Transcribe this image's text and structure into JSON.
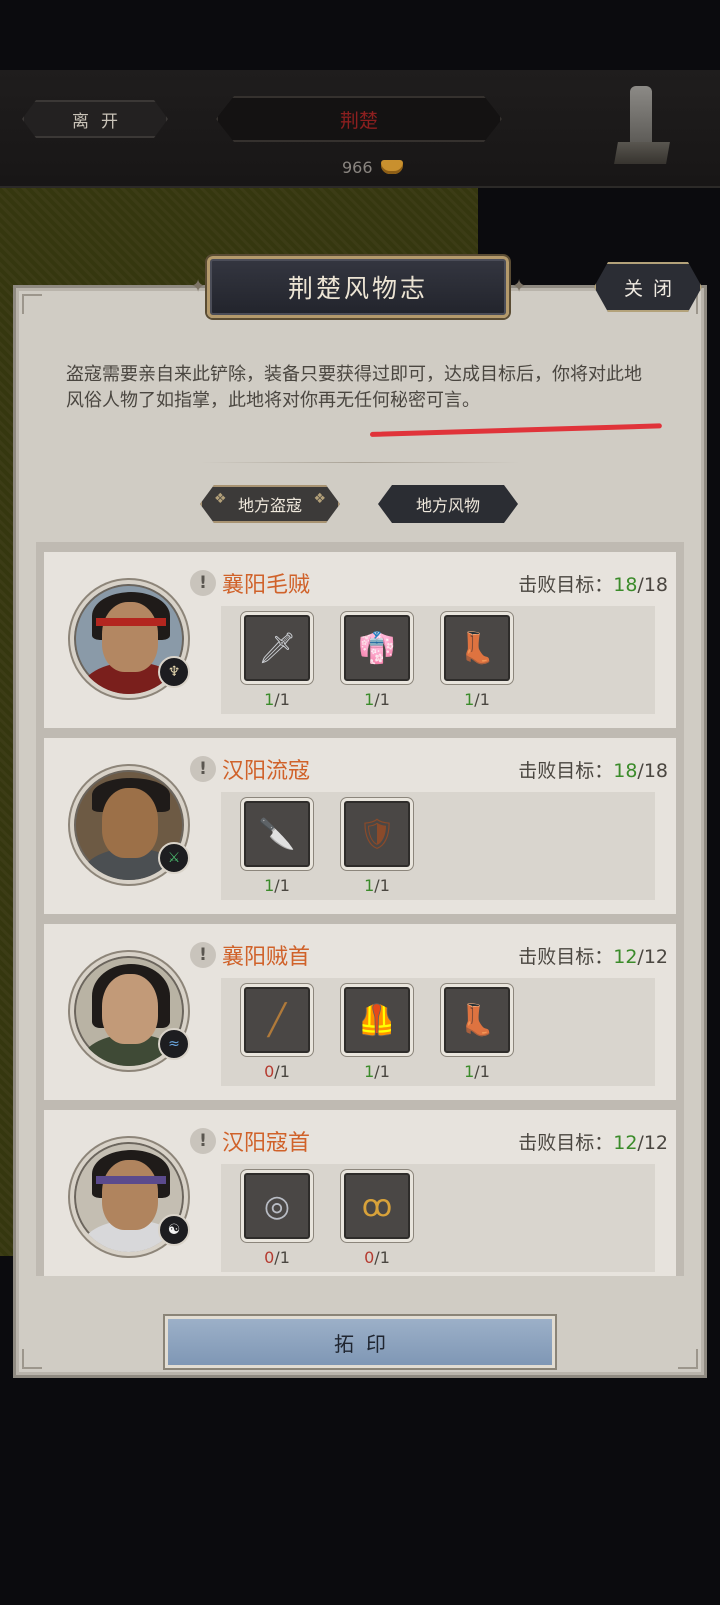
{
  "top_bar": {
    "leave_label": "离开",
    "region_name": "荆楚",
    "currency_amount": "966",
    "currency_icon": "gold-ingot-icon",
    "stele_icon": "stone-stele-icon"
  },
  "dialog": {
    "title": "荆楚风物志",
    "close_label": "关闭",
    "description": "盗寇需要亲自来此铲除，装备只要获得过即可，达成目标后，你将对此地风俗人物了如指掌，此地将对你再无任何秘密可言。",
    "tabs": [
      {
        "label": "地方盗寇",
        "selected": true
      },
      {
        "label": "地方风物",
        "selected": false
      }
    ],
    "defeat_label": "击败目标：",
    "enemies": [
      {
        "name": "襄阳毛贼",
        "defeat_current": "18",
        "defeat_total": "/18",
        "class_icon": "horned-helm-icon",
        "items": [
          {
            "icon": "sword-icon",
            "have": "1",
            "total": "/1",
            "complete": true
          },
          {
            "icon": "red-robe-icon",
            "have": "1",
            "total": "/1",
            "complete": true
          },
          {
            "icon": "boots-icon",
            "have": "1",
            "total": "/1",
            "complete": true
          }
        ]
      },
      {
        "name": "汉阳流寇",
        "defeat_current": "18",
        "defeat_total": "/18",
        "class_icon": "green-claw-icon",
        "items": [
          {
            "icon": "curved-blade-icon",
            "have": "1",
            "total": "/1",
            "complete": true
          },
          {
            "icon": "leather-bracer-icon",
            "have": "1",
            "total": "/1",
            "complete": true
          }
        ]
      },
      {
        "name": "襄阳贼首",
        "defeat_current": "12",
        "defeat_total": "/12",
        "class_icon": "blue-wave-icon",
        "items": [
          {
            "icon": "staff-icon",
            "have": "0",
            "total": "/1",
            "complete": false
          },
          {
            "icon": "chain-armor-icon",
            "have": "1",
            "total": "/1",
            "complete": true
          },
          {
            "icon": "boots-icon",
            "have": "1",
            "total": "/1",
            "complete": true
          }
        ]
      },
      {
        "name": "汉阳寇首",
        "defeat_current": "12",
        "defeat_total": "/12",
        "class_icon": "yin-yang-icon",
        "items": [
          {
            "icon": "belt-icon",
            "have": "0",
            "total": "/1",
            "complete": false
          },
          {
            "icon": "pendant-icon",
            "have": "0",
            "total": "/1",
            "complete": false
          }
        ]
      }
    ],
    "stamp_label": "拓印"
  },
  "colors": {
    "accent_orange": "#d0622a",
    "progress_green": "#3b8b2a",
    "missing_red": "#b53b30",
    "button_blue": "#8ea4bf",
    "panel_bg": "#d0ccc4",
    "annotation_red": "#e0333a"
  }
}
